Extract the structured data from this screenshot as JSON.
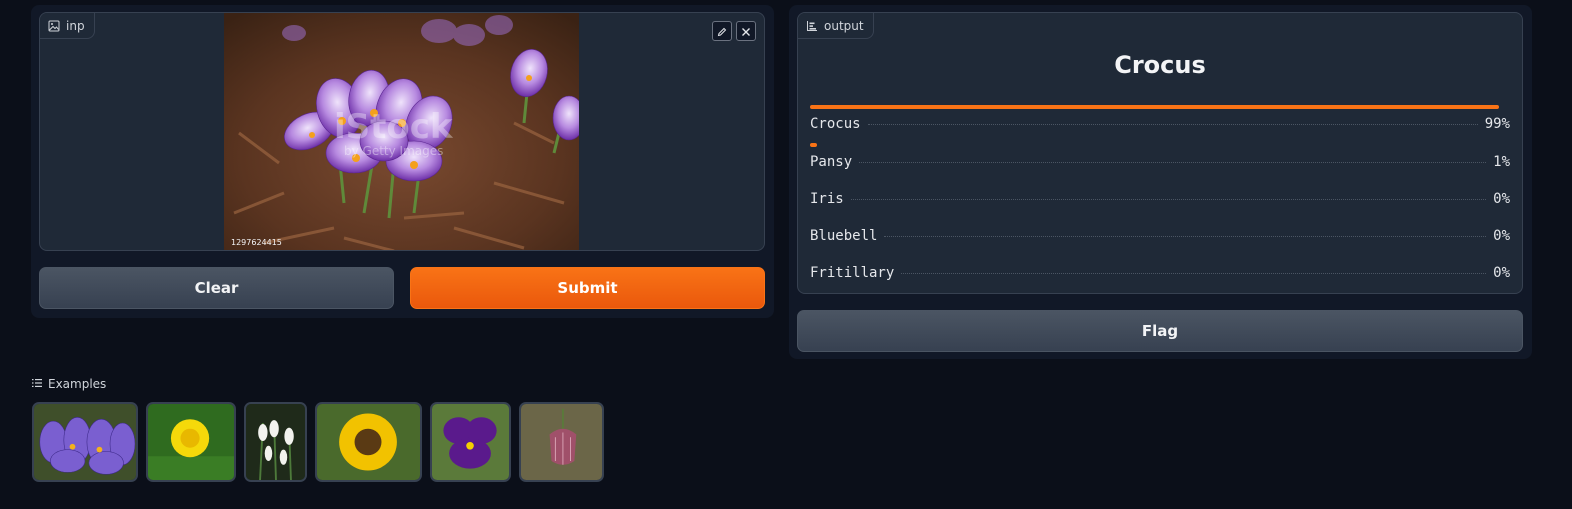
{
  "input": {
    "label": "inp",
    "icons": [
      "image-icon",
      "pencil-icon",
      "close-icon"
    ],
    "image_watermark_id": "1297624415",
    "image_watermark_text": "iStock by Getty Images"
  },
  "buttons": {
    "clear": "Clear",
    "submit": "Submit",
    "flag": "Flag"
  },
  "output": {
    "label": "output",
    "icons": [
      "bar-chart-icon"
    ],
    "top_label": "Crocus",
    "confidences": [
      {
        "label": "Crocus",
        "percent_text": "99%",
        "fraction": 0.99
      },
      {
        "label": "Pansy",
        "percent_text": "1%",
        "fraction": 0.01
      },
      {
        "label": "Iris",
        "percent_text": "0%",
        "fraction": 0.0
      },
      {
        "label": "Bluebell",
        "percent_text": "0%",
        "fraction": 0.0
      },
      {
        "label": "Fritillary",
        "percent_text": "0%",
        "fraction": 0.0
      }
    ]
  },
  "examples": {
    "header": "Examples",
    "icons": [
      "list-icon"
    ],
    "items": [
      "crocus",
      "dandelion",
      "snowdrop",
      "sunflower",
      "pansy",
      "fritillary"
    ]
  },
  "colors": {
    "background": "#0b0f19",
    "panel": "#111827",
    "block": "#1f2937",
    "accent": "#f97316"
  }
}
